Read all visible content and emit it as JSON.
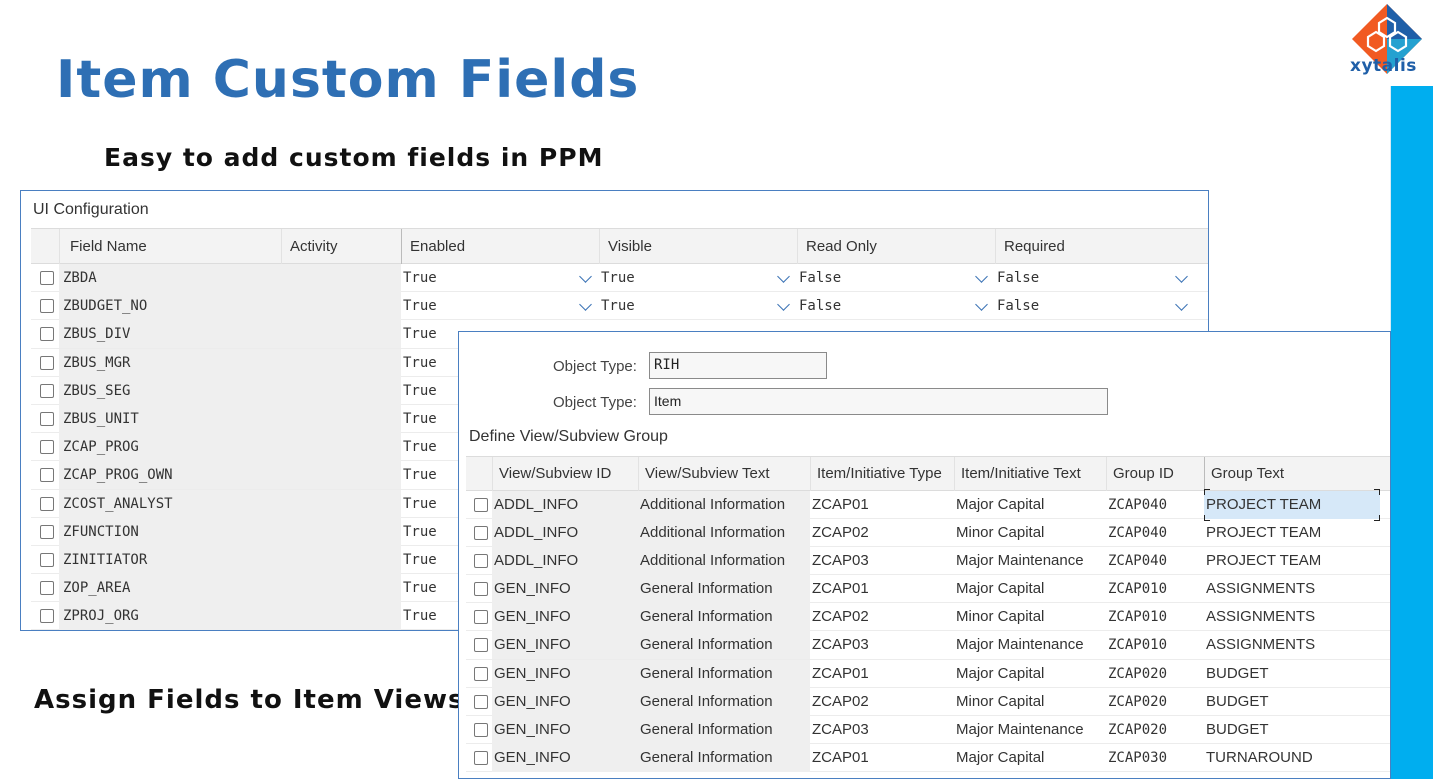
{
  "slide": {
    "title": "Item Custom Fields",
    "subtitle": "Easy to add custom fields in PPM",
    "assign_label": "Assign Fields to Item Views"
  },
  "logo": {
    "text": "xytalis",
    "colors": [
      "#f15a22",
      "#1f5fa8",
      "#00aeef"
    ]
  },
  "accent_colors": {
    "title": "#2e6fb4",
    "side_bar": "#00aeef",
    "panel_border": "#4a7fc1",
    "selected_cell": "#d6e8f8"
  },
  "ui_config": {
    "title": "UI Configuration",
    "columns": [
      "Field Name",
      "Activity",
      "Enabled",
      "Visible",
      "Read Only",
      "Required"
    ],
    "rows": [
      {
        "field": "ZBDA",
        "enabled": "True",
        "visible": "True",
        "read_only": "False",
        "required": "False"
      },
      {
        "field": "ZBUDGET_NO",
        "enabled": "True",
        "visible": "True",
        "read_only": "False",
        "required": "False"
      },
      {
        "field": "ZBUS_DIV",
        "enabled": "True"
      },
      {
        "field": "ZBUS_MGR",
        "enabled": "True"
      },
      {
        "field": "ZBUS_SEG",
        "enabled": "True"
      },
      {
        "field": "ZBUS_UNIT",
        "enabled": "True"
      },
      {
        "field": "ZCAP_PROG",
        "enabled": "True"
      },
      {
        "field": "ZCAP_PROG_OWN",
        "enabled": "True"
      },
      {
        "field": "ZCOST_ANALYST",
        "enabled": "True"
      },
      {
        "field": "ZFUNCTION",
        "enabled": "True"
      },
      {
        "field": "ZINITIATOR",
        "enabled": "True"
      },
      {
        "field": "ZOP_AREA",
        "enabled": "True"
      },
      {
        "field": "ZPROJ_ORG",
        "enabled": "True"
      }
    ]
  },
  "define_view": {
    "object_type_label": "Object Type:",
    "object_type_1": "RIH",
    "object_type_2": "Item",
    "title": "Define View/Subview Group",
    "columns": [
      "View/Subview ID",
      "View/Subview Text",
      "Item/Initiative Type",
      "Item/Initiative Text",
      "Group ID",
      "Group Text"
    ],
    "rows": [
      [
        "ADDL_INFO",
        "Additional Information",
        "ZCAP01",
        "Major Capital",
        "ZCAP040",
        "PROJECT TEAM"
      ],
      [
        "ADDL_INFO",
        "Additional Information",
        "ZCAP02",
        "Minor Capital",
        "ZCAP040",
        "PROJECT TEAM"
      ],
      [
        "ADDL_INFO",
        "Additional Information",
        "ZCAP03",
        "Major Maintenance",
        "ZCAP040",
        "PROJECT TEAM"
      ],
      [
        "GEN_INFO",
        "General Information",
        "ZCAP01",
        "Major Capital",
        "ZCAP010",
        "ASSIGNMENTS"
      ],
      [
        "GEN_INFO",
        "General Information",
        "ZCAP02",
        "Minor Capital",
        "ZCAP010",
        "ASSIGNMENTS"
      ],
      [
        "GEN_INFO",
        "General Information",
        "ZCAP03",
        "Major Maintenance",
        "ZCAP010",
        "ASSIGNMENTS"
      ],
      [
        "GEN_INFO",
        "General Information",
        "ZCAP01",
        "Major Capital",
        "ZCAP020",
        "BUDGET"
      ],
      [
        "GEN_INFO",
        "General Information",
        "ZCAP02",
        "Minor Capital",
        "ZCAP020",
        "BUDGET"
      ],
      [
        "GEN_INFO",
        "General Information",
        "ZCAP03",
        "Major Maintenance",
        "ZCAP020",
        "BUDGET"
      ],
      [
        "GEN_INFO",
        "General Information",
        "ZCAP01",
        "Major Capital",
        "ZCAP030",
        "TURNAROUND"
      ]
    ]
  }
}
